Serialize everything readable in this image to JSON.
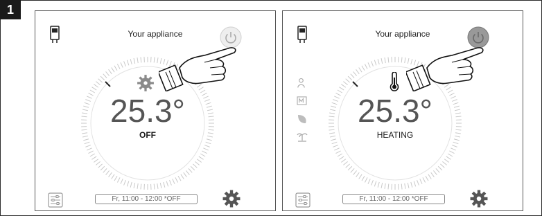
{
  "step_number": "1",
  "screens": [
    {
      "title": "Your appliance",
      "temperature": "25.3°",
      "mode": "OFF",
      "mode_icon": "settings-cog-icon",
      "schedule": "Fr, 11:00 - 12:00    *OFF",
      "power_state": "off",
      "side_icons": []
    },
    {
      "title": "Your appliance",
      "temperature": "25.3°",
      "mode": "HEATING",
      "mode_icon": "thermometer-icon",
      "schedule": "Fr, 11:00 - 12:00    *OFF",
      "power_state": "on",
      "side_icons": [
        "person-mode-icon",
        "program-icon",
        "eco-leaf-icon",
        "holiday-palm-icon"
      ]
    }
  ],
  "colors": {
    "dial_ticks": "#c9c9c9",
    "text_dark": "#1a1a1a",
    "temperature_text": "#555555",
    "power_on_fill": "#999999",
    "power_off_fill": "#eeeeee"
  }
}
